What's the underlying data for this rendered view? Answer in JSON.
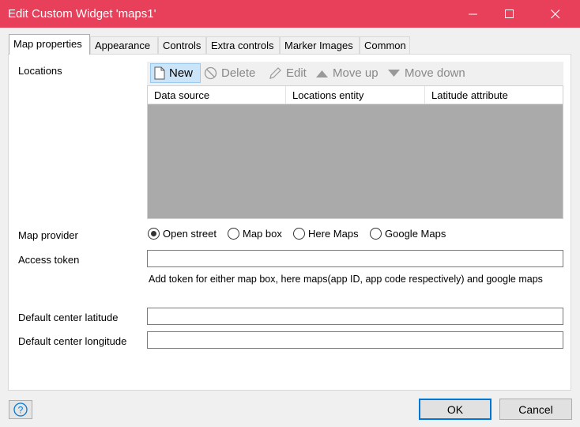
{
  "window": {
    "title": "Edit Custom Widget 'maps1'"
  },
  "tabs": [
    {
      "label": "Map properties"
    },
    {
      "label": "Appearance"
    },
    {
      "label": "Controls"
    },
    {
      "label": "Extra controls"
    },
    {
      "label": "Marker Images"
    },
    {
      "label": "Common"
    }
  ],
  "locations": {
    "label": "Locations",
    "toolbar": {
      "new_label": "New",
      "delete_label": "Delete",
      "edit_label": "Edit",
      "move_up_label": "Move up",
      "move_down_label": "Move down"
    },
    "columns": [
      "Data source",
      "Locations entity",
      "Latitude attribute"
    ]
  },
  "map_provider": {
    "label": "Map provider",
    "options": [
      "Open street",
      "Map box",
      "Here Maps",
      "Google Maps"
    ],
    "selected": "Open street"
  },
  "access_token": {
    "label": "Access token",
    "value": "",
    "hint": "Add token for either map box, here maps(app ID, app code respectively) and google maps"
  },
  "default_center_latitude": {
    "label": "Default center latitude",
    "value": ""
  },
  "default_center_longitude": {
    "label": "Default center longitude",
    "value": ""
  },
  "footer": {
    "ok_label": "OK",
    "cancel_label": "Cancel"
  },
  "colors": {
    "titlebar": "#e83f5a",
    "accent": "#0078d7"
  }
}
